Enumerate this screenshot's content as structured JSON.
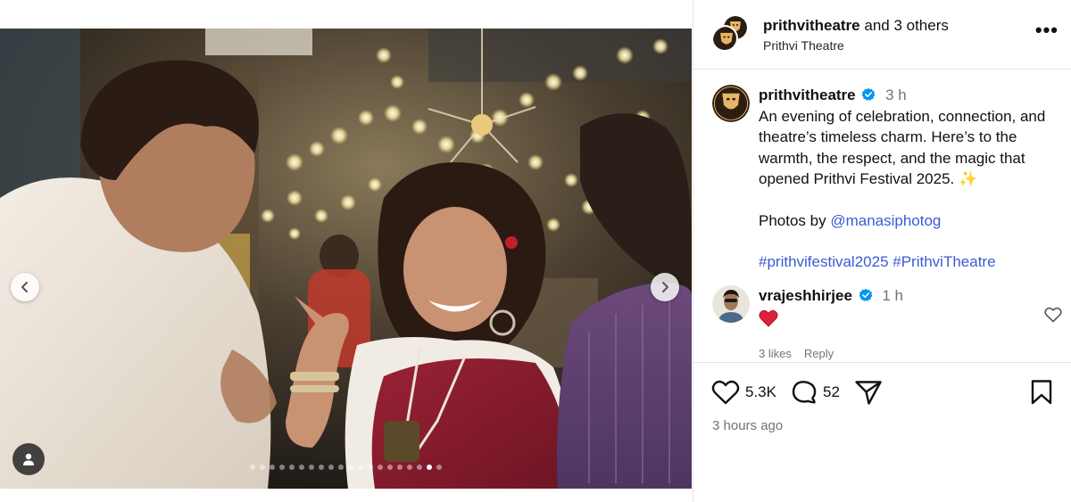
{
  "media": {
    "dots_total": 20,
    "dots_active_index": 18
  },
  "header": {
    "primary_user": "prithvitheatre",
    "collab_suffix": " and 3 others",
    "subtitle": "Prithvi Theatre",
    "more_label": "•••"
  },
  "caption": {
    "username": "prithvitheatre",
    "time": "3 h",
    "line1": "An evening of celebration, connection, and theatre’s timeless charm. Here’s to the warmth, the respect, and the magic that opened Prithvi Festival 2025. ✨",
    "photos_prefix": "Photos by ",
    "photos_mention": "@manasiphotog",
    "hashtag1": "#prithvifestival2025",
    "hashtag2": "#PrithviTheatre"
  },
  "comment": {
    "username": "vrajeshhirjee",
    "time": "1 h",
    "text": "❤️",
    "likes": "3 likes",
    "reply": "Reply"
  },
  "actions": {
    "likes_count": "5.3K",
    "comments_count": "52"
  },
  "post_time": "3 hours ago",
  "colors": {
    "link": "#3a5bd6",
    "verified": "#0095f6",
    "muted": "#737373",
    "divider": "#e6e6e6"
  }
}
